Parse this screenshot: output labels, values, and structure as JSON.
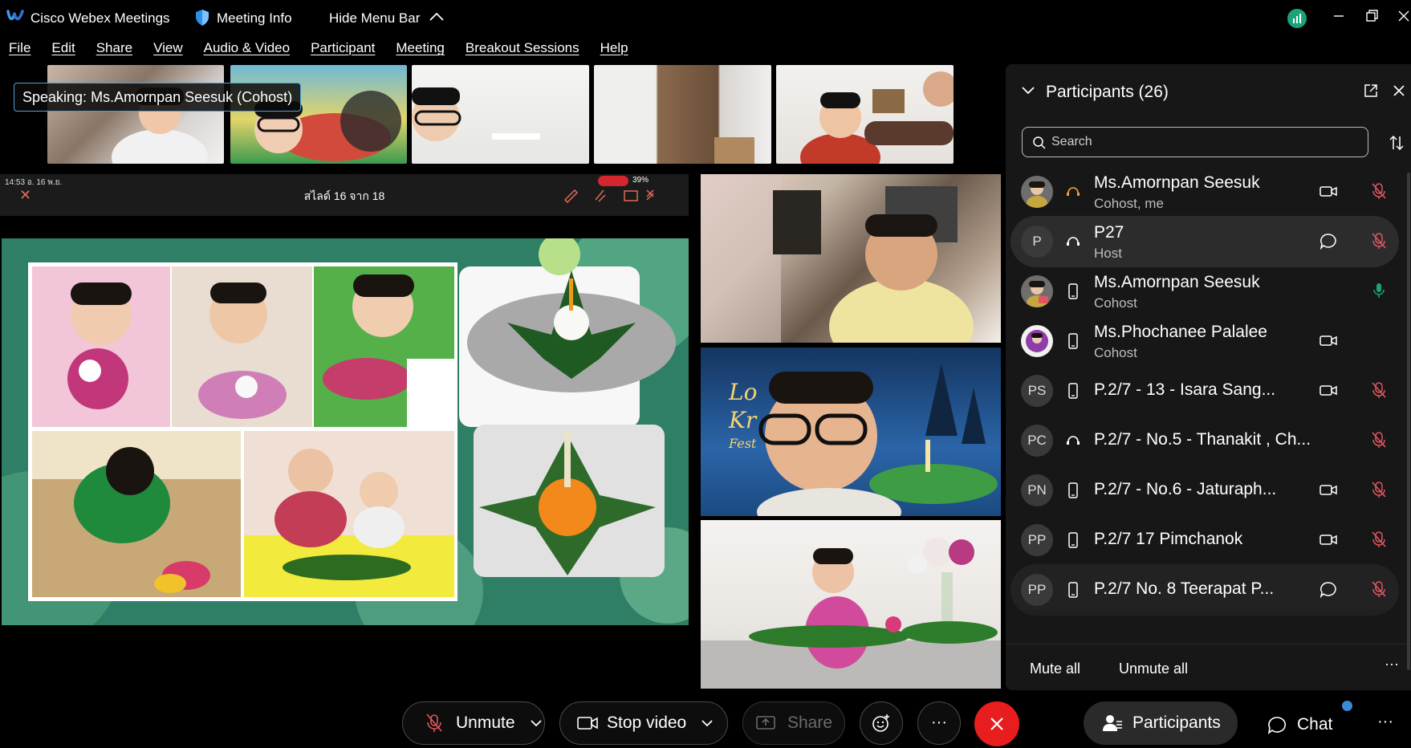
{
  "titlebar": {
    "app_name": "Cisco Webex Meetings",
    "meeting_info": "Meeting Info",
    "hide_menu": "Hide Menu Bar"
  },
  "menu": [
    "File",
    "Edit",
    "Share",
    "View",
    "Audio & Video",
    "Participant",
    "Meeting",
    "Breakout Sessions",
    "Help"
  ],
  "speaking": {
    "label": "Speaking:",
    "name": "Ms.Amornpan Seesuk (Cohost)"
  },
  "shared_slide": {
    "status_time": "14:53  อ. 16 พ.ย.",
    "slide_counter": "สไลด์ 16 จาก 18",
    "battery": "39%"
  },
  "participants_panel": {
    "title": "Participants (26)",
    "search_placeholder": "Search",
    "rows": [
      {
        "name": "Ms.Amornpan Seesuk",
        "role": "Cohost, me",
        "initials": ""
      },
      {
        "name": "P27",
        "role": "Host",
        "initials": "P"
      },
      {
        "name": "Ms.Amornpan Seesuk",
        "role": "Cohost",
        "initials": ""
      },
      {
        "name": "Ms.Phochanee Palalee",
        "role": "Cohost",
        "initials": ""
      },
      {
        "name": "P.2/7 - 13 - Isara Sang...",
        "role": "",
        "initials": "PS"
      },
      {
        "name": "P.2/7 - No.5 - Thanakit , Ch...",
        "role": "",
        "initials": "PC"
      },
      {
        "name": "P.2/7 - No.6 - Jaturaph...",
        "role": "",
        "initials": "PN"
      },
      {
        "name": "P.2/7 17 Pimchanok",
        "role": "",
        "initials": "PP"
      },
      {
        "name": "P.2/7 No. 8 Teerapat P...",
        "role": "",
        "initials": "PP"
      }
    ],
    "mute_all": "Mute all",
    "unmute_all": "Unmute all"
  },
  "bottom_bar": {
    "unmute": "Unmute",
    "stop_video": "Stop video",
    "share": "Share",
    "more": "···",
    "participants": "Participants",
    "chat": "Chat"
  },
  "colors": {
    "accent_blue": "#3b8ad9",
    "leave_red": "#e81d1d",
    "mute_red": "#e2555f",
    "unmuted_green": "#19a37b"
  }
}
